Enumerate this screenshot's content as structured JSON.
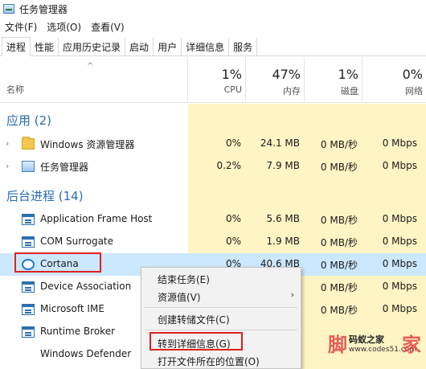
{
  "window": {
    "title": "任务管理器"
  },
  "menu": [
    "文件(F)",
    "选项(O)",
    "查看(V)"
  ],
  "tabs": [
    "进程",
    "性能",
    "应用历史记录",
    "启动",
    "用户",
    "详细信息",
    "服务"
  ],
  "active_tab": "进程",
  "header": {
    "sort_glyph": "^",
    "name_label": "名称",
    "columns": [
      {
        "pct": "1%",
        "label": "CPU"
      },
      {
        "pct": "47%",
        "label": "内存"
      },
      {
        "pct": "1%",
        "label": "磁盘"
      },
      {
        "pct": "0%",
        "label": "网络"
      }
    ]
  },
  "apps_section": {
    "title": "应用 (2)"
  },
  "apps": [
    {
      "name": "Windows 资源管理器",
      "icon": "folder-icon",
      "cpu": "0%",
      "mem": "24.1 MB",
      "disk": "0 MB/秒",
      "net": "0 Mbps"
    },
    {
      "name": "任务管理器",
      "icon": "task-manager-icon",
      "cpu": "0.2%",
      "mem": "7.9 MB",
      "disk": "0 MB/秒",
      "net": "0 Mbps"
    }
  ],
  "bg_section": {
    "title": "后台进程 (14)"
  },
  "bg_processes": [
    {
      "name": "Application Frame Host",
      "icon": "process-icon",
      "cpu": "0%",
      "mem": "5.6 MB",
      "disk": "0 MB/秒",
      "net": "0 Mbps"
    },
    {
      "name": "COM Surrogate",
      "icon": "process-icon",
      "cpu": "0%",
      "mem": "1.9 MB",
      "disk": "0 MB/秒",
      "net": "0 Mbps"
    },
    {
      "name": "Cortana",
      "icon": "cortana-icon",
      "cpu": "0%",
      "mem": "40.6 MB",
      "disk": "0 MB/秒",
      "net": "0 Mbps"
    },
    {
      "name": "Device Association",
      "icon": "process-icon",
      "cpu": "",
      "mem": "",
      "disk": "0 MB/秒",
      "net": "0 Mbps"
    },
    {
      "name": "Microsoft IME",
      "icon": "process-icon",
      "cpu": "",
      "mem": "",
      "disk": "0 MB/秒",
      "net": "0 Mbps"
    },
    {
      "name": "Runtime Broker",
      "icon": "process-icon",
      "cpu": "",
      "mem": "",
      "disk": "",
      "net": ""
    },
    {
      "name": "Windows Defender",
      "icon": "",
      "cpu": "",
      "mem": "",
      "disk": "",
      "net": ""
    }
  ],
  "context_menu": {
    "items": [
      "结束任务(E)",
      "资源值(V)",
      "创建转储文件(C)",
      "转到详细信息(G)",
      "打开文件所在的位置(O)"
    ],
    "submenu_glyph": "›"
  },
  "watermark": {
    "left_glyph": "脚",
    "right_glyph": "家",
    "name": "码蚁之家",
    "url": "www.codes51.com"
  },
  "colors": {
    "accent": "#2a6db4",
    "cell_highlight": "#fff4c4",
    "selection": "#cce8ff",
    "annotation": "#e02020"
  }
}
